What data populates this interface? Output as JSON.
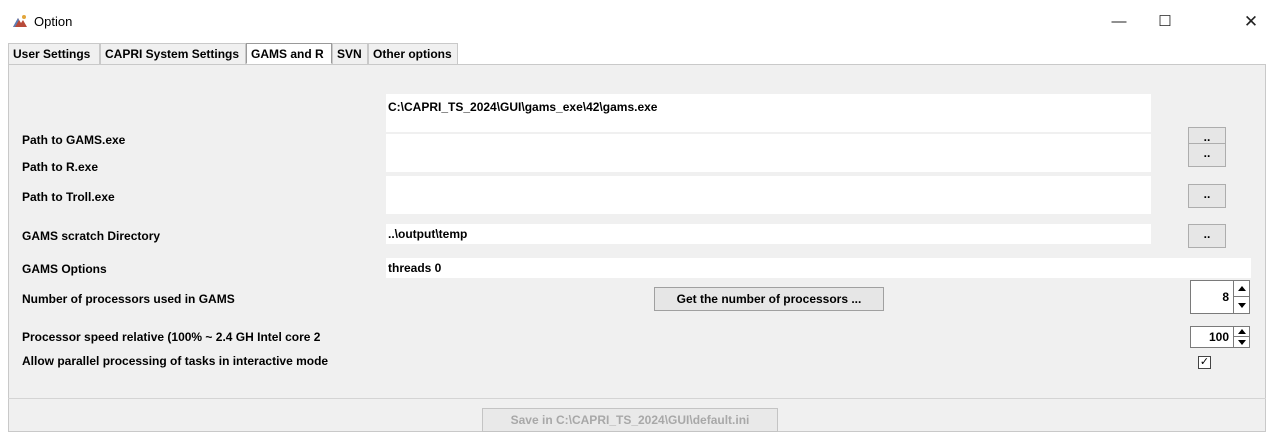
{
  "window": {
    "title": "Option",
    "minimize_glyph": "—",
    "maximize_glyph": "☐",
    "close_glyph": "✕"
  },
  "tabs": [
    {
      "label": "User Settings",
      "active": false
    },
    {
      "label": "CAPRI System Settings",
      "active": false
    },
    {
      "label": "GAMS and R",
      "active": true
    },
    {
      "label": "SVN",
      "active": false
    },
    {
      "label": "Other options",
      "active": false
    }
  ],
  "settings": {
    "gams_path": {
      "label": "Path to GAMS.exe",
      "value": "C:\\CAPRI_TS_2024\\GUI\\gams_exe\\42\\gams.exe",
      "browse": ".."
    },
    "r_path": {
      "label": "Path to R.exe",
      "value": "",
      "browse": ".."
    },
    "troll_path": {
      "label": "Path to Troll.exe",
      "value": "",
      "browse": ".."
    },
    "scratch_dir": {
      "label": "GAMS scratch Directory",
      "value": "..\\output\\temp",
      "browse": ".."
    },
    "gams_options": {
      "label": "GAMS Options",
      "value": "threads 0"
    },
    "num_processors": {
      "label": "Number of processors used in GAMS",
      "button": "Get the number of processors ...",
      "value": "8"
    },
    "processor_speed": {
      "label": "Processor speed relative (100% ~ 2.4 GH Intel core 2",
      "value": "100"
    },
    "parallel": {
      "label": "Allow parallel processing of tasks in interactive mode",
      "checked": true,
      "check_glyph": "✓"
    }
  },
  "save_button": {
    "label": "Save in C:\\CAPRI_TS_2024\\GUI\\default.ini"
  }
}
